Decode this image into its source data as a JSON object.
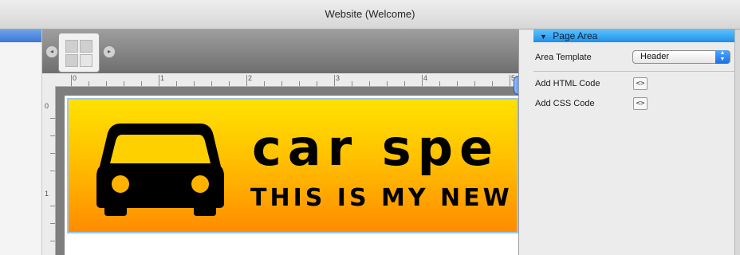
{
  "window": {
    "title": "Website (Welcome)"
  },
  "banner": {
    "title": "car spe",
    "tagline": "This is my New"
  },
  "ruler": {
    "top_numbers": [
      "0",
      "1",
      "2",
      "3",
      "4",
      "5"
    ],
    "left_numbers": [
      "0",
      "1"
    ]
  },
  "inspector": {
    "section_title": "Page Area",
    "area_template_label": "Area Template",
    "area_template_value": "Header",
    "add_html_label": "Add HTML Code",
    "add_css_label": "Add CSS Code",
    "code_button_glyph": "<>"
  },
  "icons": [
    "car-icon",
    "disclosure-triangle-icon",
    "layout-template-icon",
    "popup-arrows-icon"
  ],
  "colors": {
    "banner_top": "#ffe100",
    "banner_bottom": "#ff8c00",
    "inspector_header": "#1e8ee8"
  }
}
